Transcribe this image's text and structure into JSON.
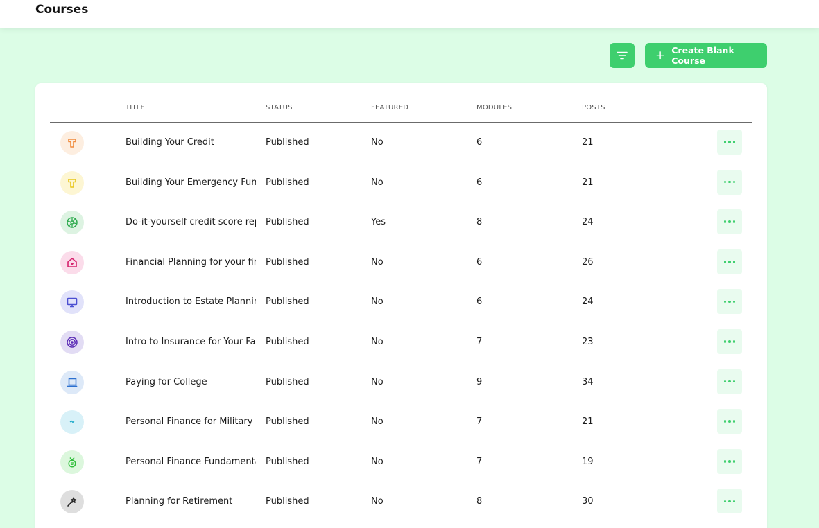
{
  "header": {
    "title": "Courses"
  },
  "toolbar": {
    "filter_icon": "filter-icon",
    "create_label": "Create Blank Course",
    "accent": "#3ecf6e"
  },
  "table": {
    "columns": [
      "TITLE",
      "STATUS",
      "FEATURED",
      "MODULES",
      "POSTS"
    ],
    "rows": [
      {
        "icon": "hammer-icon",
        "icon_color": "#f08a3c",
        "icon_bg": "#fdeee0",
        "title": "Building Your Credit",
        "status": "Published",
        "featured": "No",
        "modules": "6",
        "posts": "21"
      },
      {
        "icon": "hammer-icon",
        "icon_color": "#e8c51a",
        "icon_bg": "#fdf6d3",
        "title": "Building Your Emergency Fund",
        "status": "Published",
        "featured": "No",
        "modules": "6",
        "posts": "21"
      },
      {
        "icon": "wheel-icon",
        "icon_color": "#2eaa4e",
        "icon_bg": "#ddf3e2",
        "title": "Do-it-yourself credit score repair",
        "status": "Published",
        "featured": "Yes",
        "modules": "8",
        "posts": "24"
      },
      {
        "icon": "home-icon",
        "icon_color": "#d6246e",
        "icon_bg": "#fbdcea",
        "title": "Financial Planning for your first home",
        "status": "Published",
        "featured": "No",
        "modules": "6",
        "posts": "26"
      },
      {
        "icon": "monitor-icon",
        "icon_color": "#4b4fd1",
        "icon_bg": "#e1e2fa",
        "title": "Introduction to Estate Planning",
        "status": "Published",
        "featured": "No",
        "modules": "6",
        "posts": "24"
      },
      {
        "icon": "target-icon",
        "icon_color": "#5b2bb5",
        "icon_bg": "#e2dcf4",
        "title": "Intro to Insurance for Your Family",
        "status": "Published",
        "featured": "No",
        "modules": "7",
        "posts": "23"
      },
      {
        "icon": "laptop-icon",
        "icon_color": "#2b6fcf",
        "icon_bg": "#dde9f8",
        "title": "Paying for College",
        "status": "Published",
        "featured": "No",
        "modules": "9",
        "posts": "34"
      },
      {
        "icon": "heart-icon",
        "icon_color": "#1aa9c9",
        "icon_bg": "#d8f1f8",
        "title": "Personal Finance for Military Families",
        "status": "Published",
        "featured": "No",
        "modules": "7",
        "posts": "21"
      },
      {
        "icon": "medal-icon",
        "icon_color": "#2fbf3a",
        "icon_bg": "#dcf7dd",
        "title": "Personal Finance Fundamentals",
        "status": "Published",
        "featured": "No",
        "modules": "7",
        "posts": "19"
      },
      {
        "icon": "wand-icon",
        "icon_color": "#222222",
        "icon_bg": "#dedede",
        "title": "Planning for Retirement",
        "status": "Published",
        "featured": "No",
        "modules": "8",
        "posts": "30"
      }
    ]
  }
}
